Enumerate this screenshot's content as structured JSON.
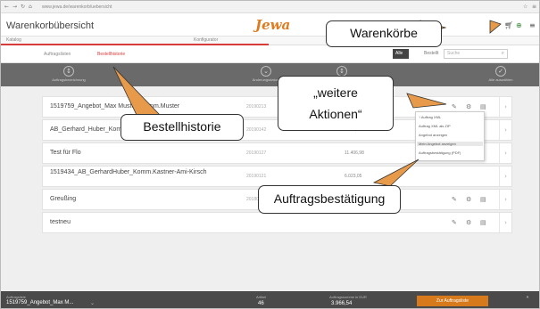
{
  "browser": {
    "url": "www.jewa.de/warenkorb/uebersicht",
    "icons": [
      "back-arrow-icon",
      "forward-arrow-icon",
      "reload-icon",
      "home-icon"
    ]
  },
  "header": {
    "title": "Warenkorbübersicht",
    "logo": "Jewa",
    "icons": [
      "cart-icon",
      "cart-add-icon",
      "menu-icon"
    ]
  },
  "subnav": {
    "left": "Katalog",
    "right": "Konfigurator"
  },
  "tabs": {
    "auftrag": "Auftragslisten",
    "bestell": "Bestellhistorie",
    "filter_alle": "Alle",
    "filter_bestellt": "Bestellt",
    "search_placeholder": "Suche"
  },
  "columns": {
    "c1": "Auftragsbezeichnung",
    "c2": "Änderungsdatum",
    "c3": "Auftragssumme",
    "c4": "Alle auswählen"
  },
  "rows": [
    {
      "name": "1519759_Angebot_Max Muster_Komm.Muster",
      "date": "20190213",
      "sum": ""
    },
    {
      "name": "AB_Gerhard_Huber_Komm_Huber",
      "date": "20190142",
      "sum": "4.711,39"
    },
    {
      "name": "Test für Flo",
      "date": "20190127",
      "sum": "11.406,98"
    },
    {
      "name": "1519434_AB_GerhardHuber_Komm.Kastner-Ami-Kirsch",
      "date": "20190121",
      "sum": "6.023,05"
    },
    {
      "name": "Greußing",
      "date": "20180913",
      "sum": ""
    },
    {
      "name": "testneu",
      "date": "",
      "sum": ""
    }
  ],
  "dropdown": {
    "items": [
      "↑ Auftrag XML",
      "Auftrag XML als ZIP",
      "Angebot anzeigen",
      "Mein Angebot anzeigen",
      "Auftragsbestätigung (PDF)"
    ]
  },
  "footer": {
    "label_auftragsliste": "Auftragsliste",
    "auftragsliste": "1519759_Angebot_Max M...",
    "label_artikel": "Artikel",
    "artikel": "46",
    "label_summe": "Auftragssumme in EUR",
    "summe": "3.966,54",
    "button": "Zur Auftragsliste"
  },
  "callouts": {
    "warenkoerbe": "Warenkörbe",
    "bestellhistorie": "Bestellhistorie",
    "weitere_line1": "„weitere",
    "weitere_line2": "Aktionen“",
    "auftragsbestaetigung": "Auftragsbestätigung"
  },
  "colors": {
    "accent": "#d93a3a",
    "orange": "#e07a1e",
    "band": "#6a6a6a",
    "footer": "#4a4a4a"
  }
}
